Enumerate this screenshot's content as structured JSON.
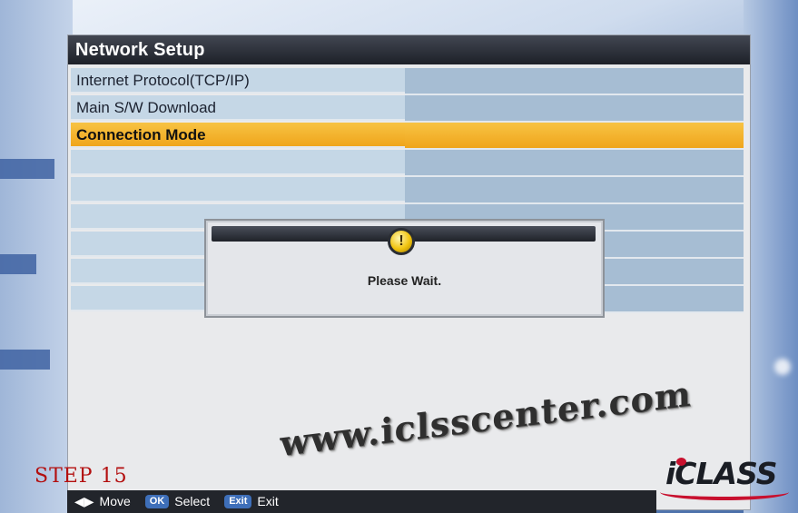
{
  "screen": {
    "title": "Network Setup",
    "menu_items": [
      {
        "label": "Internet Protocol(TCP/IP)",
        "selected": false
      },
      {
        "label": "Main S/W Download",
        "selected": false
      },
      {
        "label": "Connection Mode",
        "selected": true
      },
      {
        "label": "",
        "selected": false
      },
      {
        "label": "",
        "selected": false
      },
      {
        "label": "",
        "selected": false
      },
      {
        "label": "",
        "selected": false
      },
      {
        "label": "",
        "selected": false
      },
      {
        "label": "",
        "selected": false
      }
    ]
  },
  "dialog": {
    "icon": "info-icon",
    "message": "Please Wait."
  },
  "watermark": "www.iclsscenter.com",
  "step_label": "STEP 15",
  "logo": "iCLASS",
  "footer": {
    "move_icon": "◀▶",
    "move_label": "Move",
    "ok_key": "OK",
    "select_label": "Select",
    "exit_key": "Exit",
    "exit_label": "Exit"
  },
  "colors": {
    "highlight": "#f0a51b",
    "title_bar": "#1d2028",
    "step_text": "#b30f0f",
    "logo_accent": "#c8102e"
  }
}
